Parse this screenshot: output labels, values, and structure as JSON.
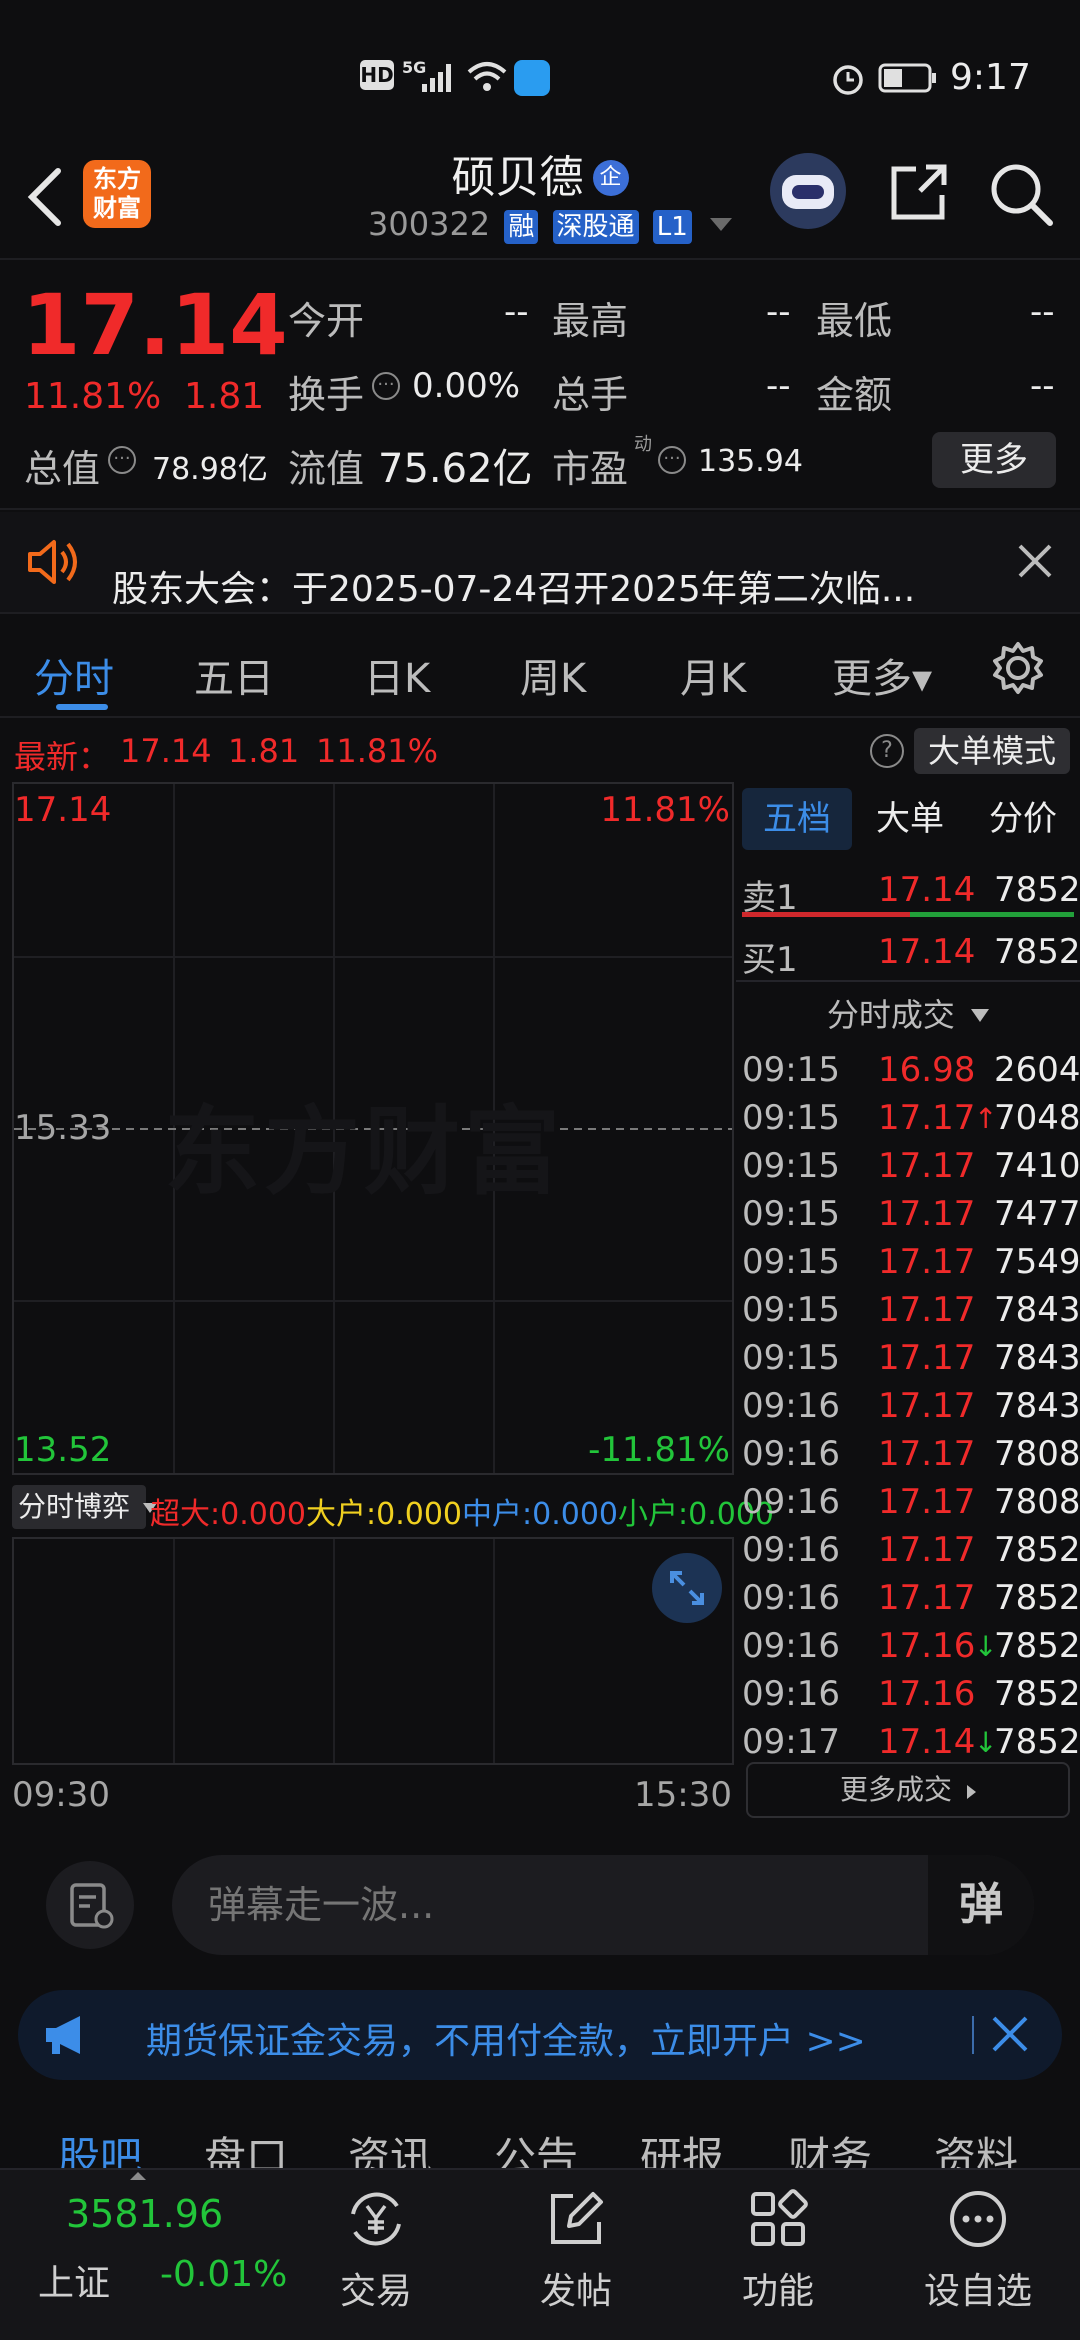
{
  "status_bar": {
    "indicators": [
      "HD",
      "5G"
    ],
    "time": "9:17"
  },
  "header": {
    "logo_text": "东方财富",
    "stock_name": "硕贝德",
    "stock_code": "300322",
    "badges": {
      "enterprise": "企",
      "margin": "融",
      "connect": "深股通",
      "level": "L1"
    }
  },
  "quote": {
    "price": "17.14",
    "change_pct": "11.81%",
    "change": "1.81",
    "open_label": "今开",
    "open": "--",
    "high_label": "最高",
    "high": "--",
    "low_label": "最低",
    "low": "--",
    "turnover_label": "换手",
    "turnover": "0.00%",
    "volume_label": "总手",
    "volume": "--",
    "amount_label": "金额",
    "amount": "--",
    "mktcap_label": "总值",
    "mktcap": "78.98亿",
    "float_label": "流值",
    "float": "75.62亿",
    "pe_label": "市盈",
    "pe_sup": "动",
    "pe": "135.94",
    "more_button": "更多"
  },
  "notice": {
    "text": "股东大会：于2025-07-24召开2025年第二次临..."
  },
  "tabs": [
    {
      "label": "分时"
    },
    {
      "label": "五日"
    },
    {
      "label": "日K"
    },
    {
      "label": "周K"
    },
    {
      "label": "月K"
    },
    {
      "label": "更多▾"
    }
  ],
  "chart": {
    "latest_label": "最新：",
    "latest_price": "17.14",
    "latest_change": "1.81",
    "latest_pct": "11.81%",
    "mode_button": "大单模式",
    "help_icon": "?",
    "top_price": "17.14",
    "top_pct": "11.81%",
    "mid_price": "15.33",
    "bottom_price": "13.52",
    "bottom_pct": "-11.81%",
    "watermark": "东方财富",
    "flow_selector": "分时博弈",
    "flow": [
      {
        "label": "超大:0.000",
        "color": "#f02a2a"
      },
      {
        "label": "大户:0.000",
        "color": "#f0d020"
      },
      {
        "label": "中户:0.000",
        "color": "#3c8de8"
      },
      {
        "label": "小户:0.000",
        "color": "#22c53a"
      }
    ],
    "time_start": "09:30",
    "time_end": "15:30"
  },
  "right_panel": {
    "tabs": [
      "五档",
      "大单",
      "分价"
    ],
    "sell1": {
      "label": "卖1",
      "price": "17.14",
      "qty": "7852"
    },
    "buy1": {
      "label": "买1",
      "price": "17.14",
      "qty": "7852"
    },
    "trades_title": "分时成交",
    "trades": [
      {
        "time": "09:15",
        "price": "16.98",
        "arrow": "",
        "qty": "2604"
      },
      {
        "time": "09:15",
        "price": "17.17",
        "arrow": "↑",
        "qty": "7048"
      },
      {
        "time": "09:15",
        "price": "17.17",
        "arrow": "",
        "qty": "7410"
      },
      {
        "time": "09:15",
        "price": "17.17",
        "arrow": "",
        "qty": "7477"
      },
      {
        "time": "09:15",
        "price": "17.17",
        "arrow": "",
        "qty": "7549"
      },
      {
        "time": "09:15",
        "price": "17.17",
        "arrow": "",
        "qty": "7843"
      },
      {
        "time": "09:15",
        "price": "17.17",
        "arrow": "",
        "qty": "7843"
      },
      {
        "time": "09:16",
        "price": "17.17",
        "arrow": "",
        "qty": "7843"
      },
      {
        "time": "09:16",
        "price": "17.17",
        "arrow": "",
        "qty": "7808"
      },
      {
        "time": "09:16",
        "price": "17.17",
        "arrow": "",
        "qty": "7808"
      },
      {
        "time": "09:16",
        "price": "17.17",
        "arrow": "",
        "qty": "7852"
      },
      {
        "time": "09:16",
        "price": "17.17",
        "arrow": "",
        "qty": "7852"
      },
      {
        "time": "09:16",
        "price": "17.16",
        "arrow": "↓",
        "qty": "7852"
      },
      {
        "time": "09:16",
        "price": "17.16",
        "arrow": "",
        "qty": "7852"
      },
      {
        "time": "09:17",
        "price": "17.14",
        "arrow": "↓",
        "qty": "7852"
      }
    ],
    "more_trades": "更多成交"
  },
  "comment": {
    "placeholder": "弹幕走一波...",
    "danmu_button": "弹"
  },
  "ad": {
    "text": "期货保证金交易，不用付全款，立即开户 >>"
  },
  "bottom_tabs": [
    "股吧",
    "盘口",
    "资讯",
    "公告",
    "研报",
    "财务",
    "资料"
  ],
  "bottom_nav": {
    "index_value": "3581.96",
    "index_name": "上证",
    "index_change": "-0.01%",
    "items": [
      {
        "label": "交易",
        "icon": "yen-refresh-icon"
      },
      {
        "label": "发帖",
        "icon": "edit-icon"
      },
      {
        "label": "功能",
        "icon": "grid-icon"
      },
      {
        "label": "设自选",
        "icon": "more-icon"
      }
    ]
  }
}
